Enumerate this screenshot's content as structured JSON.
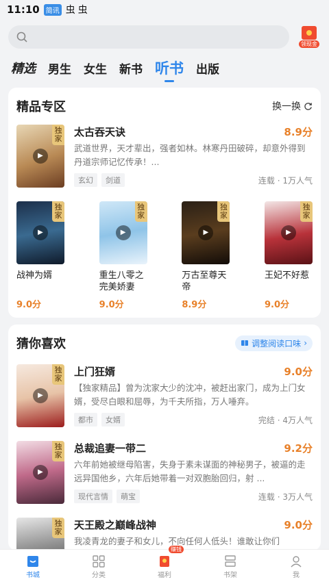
{
  "status": {
    "time": "11:10",
    "badge": "简讯",
    "icons": [
      "虫",
      "虫"
    ]
  },
  "search": {
    "placeholder": ""
  },
  "redpacket": {
    "label": "领现金"
  },
  "tabs": [
    {
      "label": "精选"
    },
    {
      "label": "男生"
    },
    {
      "label": "女生"
    },
    {
      "label": "新书"
    },
    {
      "label": "听书"
    },
    {
      "label": "出版"
    }
  ],
  "premium": {
    "title": "精品专区",
    "refresh": "换一换",
    "featured": {
      "title": "太古吞天诀",
      "score": "8.9分",
      "desc": "武道世界，天才辈出，强者如林。林寒丹田破碎，却意外得到丹道宗师记忆传承！...",
      "tags": [
        "玄幻",
        "剑道"
      ],
      "meta": "连载 · 1万人气",
      "exclusive": "独家"
    },
    "grid": [
      {
        "title": "战神为婿",
        "score": "9.0分",
        "exclusive": "独家"
      },
      {
        "title": "重生八零之完美娇妻",
        "score": "9.0分",
        "exclusive": "独家"
      },
      {
        "title": "万古至尊天帝",
        "score": "8.9分",
        "exclusive": "独家"
      },
      {
        "title": "王妃不好惹",
        "score": "9.0分",
        "exclusive": "独家"
      }
    ]
  },
  "guess": {
    "title": "猜你喜欢",
    "adjust": "调整阅读口味",
    "books": [
      {
        "title": "上门狂婿",
        "score": "9.0分",
        "desc": "【独家精品】曾为沈家大少的沈冲，被赶出家门，成为上门女婿，受尽白眼和屈辱，为千夫所指，万人唾弃。",
        "tags": [
          "都市",
          "女婿"
        ],
        "meta": "完结 · 4万人气",
        "exclusive": "独家"
      },
      {
        "title": "总裁追妻一带二",
        "score": "9.2分",
        "desc": "六年前她被继母陷害，失身于素未谋面的神秘男子，被逼的走远异国他乡，六年后她带着一对双胞胎回归，射 ...",
        "tags": [
          "现代言情",
          "萌宝"
        ],
        "meta": "连载 · 3万人气",
        "exclusive": "独家"
      },
      {
        "title": "天王殿之巅峰战神",
        "score": "9.0分",
        "desc": "我凌青龙的妻子和女儿，不向任何人低头！谁敢让你们",
        "tags": [],
        "meta": "",
        "exclusive": "独家"
      }
    ]
  },
  "nav": [
    {
      "label": "书城"
    },
    {
      "label": "分类"
    },
    {
      "label": "福利",
      "badge": "赚钱"
    },
    {
      "label": "书架"
    },
    {
      "label": "我"
    }
  ],
  "colors": {
    "accent": "#2f86ea",
    "score": "#e8812a",
    "red": "#f04b2f"
  }
}
